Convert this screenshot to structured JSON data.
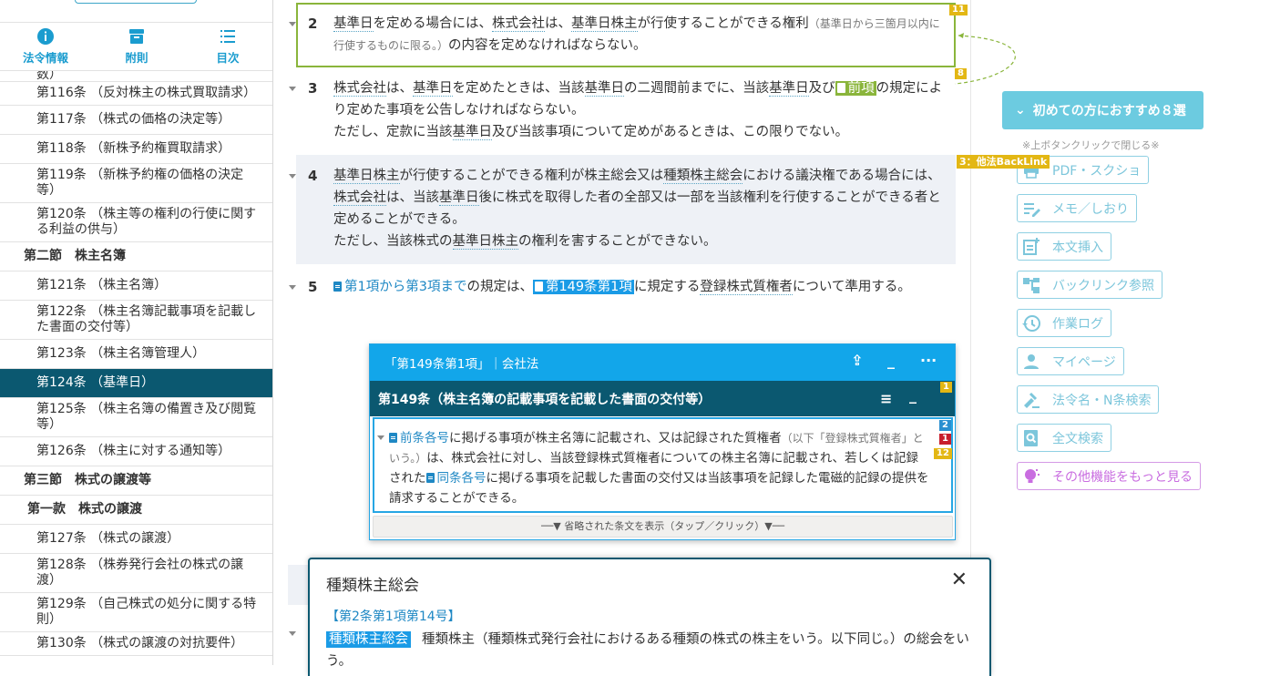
{
  "sidebar": {
    "tabs": [
      {
        "label": "法令情報",
        "icon": "info-icon"
      },
      {
        "label": "附則",
        "icon": "archive-icon"
      },
      {
        "label": "目次",
        "icon": "list-icon"
      }
    ],
    "items": [
      {
        "text": "数）",
        "kind": "partial"
      },
      {
        "text": "第116条 （反対株主の株式買取請求）",
        "kind": "item"
      },
      {
        "text": "第117条 （株式の価格の決定等）",
        "kind": "single"
      },
      {
        "text": "第118条 （新株予約権買取請求）",
        "kind": "single"
      },
      {
        "text": "第119条 （新株予約権の価格の決定等）",
        "kind": "item"
      },
      {
        "text": "第120条 （株主等の権利の行使に関する利益の供与）",
        "kind": "item"
      },
      {
        "text": "第二節　株主名簿",
        "kind": "sec"
      },
      {
        "text": "第121条 （株主名簿）",
        "kind": "single"
      },
      {
        "text": "第122条 （株主名簿記載事項を記載した書面の交付等）",
        "kind": "item"
      },
      {
        "text": "第123条 （株主名簿管理人）",
        "kind": "single"
      },
      {
        "text": "第124条 （基準日）",
        "kind": "active"
      },
      {
        "text": "第125条 （株主名簿の備置き及び閲覧等）",
        "kind": "item"
      },
      {
        "text": "第126条 （株主に対する通知等）",
        "kind": "single"
      },
      {
        "text": "第三節　株式の譲渡等",
        "kind": "sec"
      },
      {
        "text": "第一款　株式の譲渡",
        "kind": "sub"
      },
      {
        "text": "第127条 （株式の譲渡）",
        "kind": "single"
      },
      {
        "text": "第128条 （株券発行会社の株式の譲渡）",
        "kind": "item"
      },
      {
        "text": "第129条 （自己株式の処分に関する特則）",
        "kind": "item"
      },
      {
        "text": "第130条 （株式の譲渡の対抗要件）",
        "kind": "item"
      }
    ]
  },
  "main": {
    "p2": {
      "num": "2",
      "t1": "基準日",
      "t2": "を定める場合には、",
      "t3": "株式会社",
      "t4": "は、",
      "t5": "基準日株主",
      "t6": "が行使することができる権利",
      "paren": "（基準日から三箇月以内に行使するものに限る。）",
      "t7": "の内容を定めなければならない。",
      "badge_top": "11",
      "badge_bottom": "8"
    },
    "p3": {
      "num": "3",
      "a1": "株式会社",
      "a2": "は、",
      "a3": "基準日",
      "a4": "を定めたときは、当該",
      "a5": "基準日",
      "a6": "の二週間前までに、当該",
      "a7": "基準日",
      "a8": "及び",
      "ref": "前項",
      "a9": "の規定により定めた事項を公告しなければならない。",
      "line3a": "ただし、定款に当該",
      "line3b": "基準日",
      "line3c": "及び当該事項について定めがあるときは、この限りでない。"
    },
    "p4": {
      "num": "4",
      "b1": "基準日株主",
      "b2": "が行使することができる権利が株主総会又は",
      "b3": "種類株主総会",
      "b4": "における議決権である場合には、",
      "b5": "株式会社",
      "b6": "は、当該",
      "b7": "基準日",
      "b8": "後に株式を取得した者の全部又は一部を当該権利を行使することができる者と定めることができる。",
      "c1": "ただし、当該株式の",
      "c2": "基準日株主",
      "c3": "の権利を害することができない。"
    },
    "p5": {
      "num": "5",
      "ref1": "第1項から第3項まで",
      "d1": "の規定は、",
      "ref2": "第149条第1項",
      "d2": "に規定する",
      "d3": "登録株式質権者",
      "d4": "について準用する。"
    }
  },
  "popup149": {
    "header": "「第149条第1項」｜会社法",
    "subtitle": "第149条（株主名簿の記載事項を記載した書面の交付等）",
    "badge_yellow": "1",
    "badges": [
      "2",
      "1",
      "12"
    ],
    "ref1": "前条各号",
    "e1": "に掲げる事項が株主名簿に記載され、又は記録された質権者",
    "paren": "（以下「登録株式質権者」という。）",
    "e2": "は、株式会社に対し、当該登録株式質権者についての株主名簿に記載され、若しくは記録された",
    "ref2": "同条各号",
    "e3": "に掲げる事項を記載した書面の交付又は当該事項を記録した電磁的記録の提供を請求することができる。",
    "expand": "──▼ 省略された条文を表示（タップ／クリック）▼──"
  },
  "defpopup": {
    "title": "種類株主総会",
    "ref": "【第2条第1項第14号】",
    "term": "種類株主総会",
    "text": "種類株主（種類株式発行会社におけるある種類の株式の株主をいう。以下同じ。）の総会をいう。"
  },
  "right": {
    "recommend": "初めての方におすすめ８選",
    "note": "※上ボタンクリックで閉じる※",
    "backlink_tag": "3：他法BackLink",
    "tools": [
      {
        "label": "PDF・スクショ",
        "icon": "printer-icon"
      },
      {
        "label": "メモ／しおり",
        "icon": "memo-icon"
      },
      {
        "label": "本文挿入",
        "icon": "insert-icon"
      },
      {
        "label": "バックリンク参照",
        "icon": "backlink-icon"
      },
      {
        "label": "作業ログ",
        "icon": "history-icon"
      },
      {
        "label": "マイページ",
        "icon": "user-icon"
      },
      {
        "label": "法令名・N条検索",
        "icon": "gavel-icon"
      },
      {
        "label": "全文検索",
        "icon": "search-doc-icon"
      },
      {
        "label": "その他機能をもっと見る",
        "icon": "bulb-icon"
      }
    ]
  },
  "colors": {
    "brand_dark": "#0b5870",
    "accent_blue": "#12a6ea",
    "accent_green": "#8ab53b",
    "badge_yellow": "#e3b714",
    "tool_border": "#8fd0e3",
    "purple": "#c96de0"
  }
}
